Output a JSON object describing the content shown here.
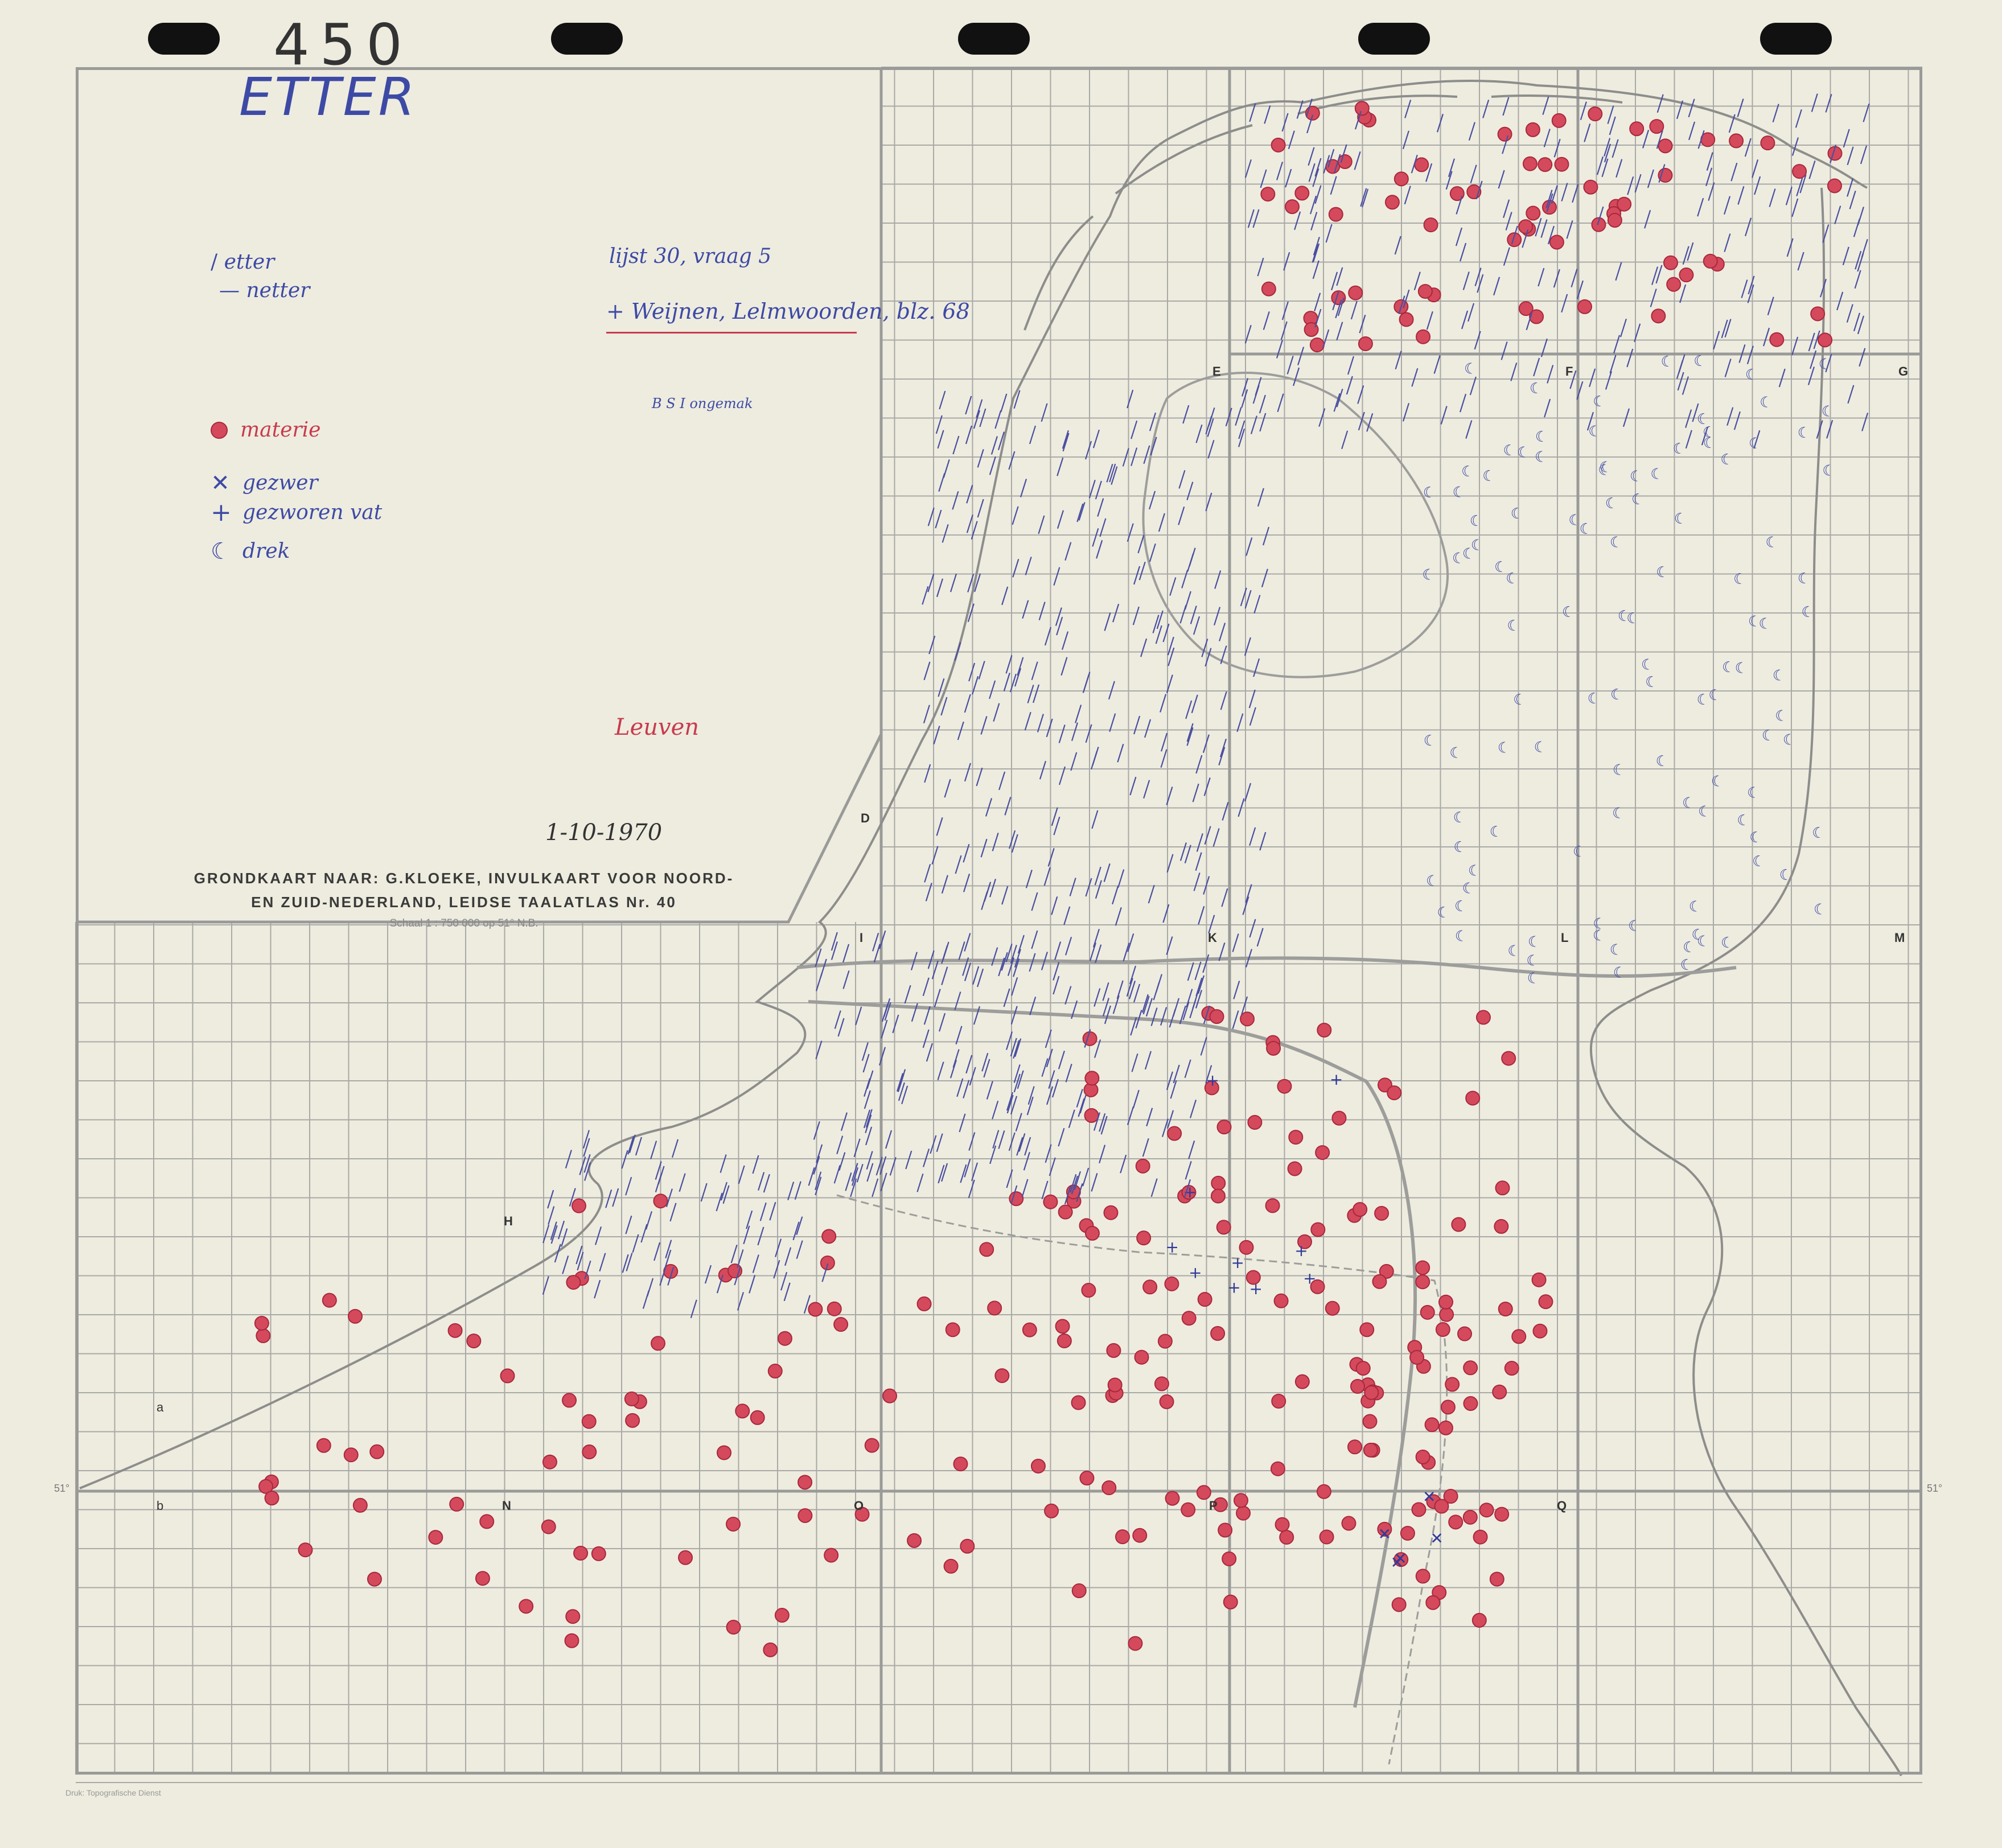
{
  "sheet_number": "450",
  "map_title": "ETTER",
  "legend": {
    "etter": "etter",
    "netter": "netter",
    "materie": "materie",
    "gezwer": "gezwer",
    "gezworen": "gezworen vat",
    "drek": "drek"
  },
  "notes": {
    "note_1": "lijst 30, vraag 5",
    "note_2": "+ Weijnen, Lelmwoorden, blz. 68",
    "note_3": "B S I ongemak",
    "note_4": "Leuven",
    "date": "1-10-1970"
  },
  "base_map_credit": {
    "line_1": "GRONDKAART NAAR: G.KLOEKE, INVULKAART VOOR NOORD-",
    "line_2": "EN ZUID-NEDERLAND, LEIDSE TAALATLAS Nr. 40"
  },
  "scale_note": "Schaal 1 : 750 000 op 51° N.B.",
  "print_credit": "Druk: Topografische Dienst",
  "sheet_labels": [
    "D",
    "E",
    "F",
    "G",
    "H",
    "I",
    "K",
    "L",
    "M",
    "N",
    "O",
    "P",
    "Q",
    "a",
    "b"
  ],
  "latitude_label": "51°",
  "colors": {
    "materie": "#d44a5c",
    "gezwer_blue": "#2f3a9a",
    "drek_blue": "#3d4aa5",
    "etter_ink": "#4a4fa0",
    "grid": "#a9a9a6",
    "paper": "#eeecdf"
  },
  "icons": {
    "materie": "red-dot-icon",
    "gezwer": "cross-x-icon",
    "gezworen": "plus-icon",
    "drek": "crescent-icon"
  }
}
